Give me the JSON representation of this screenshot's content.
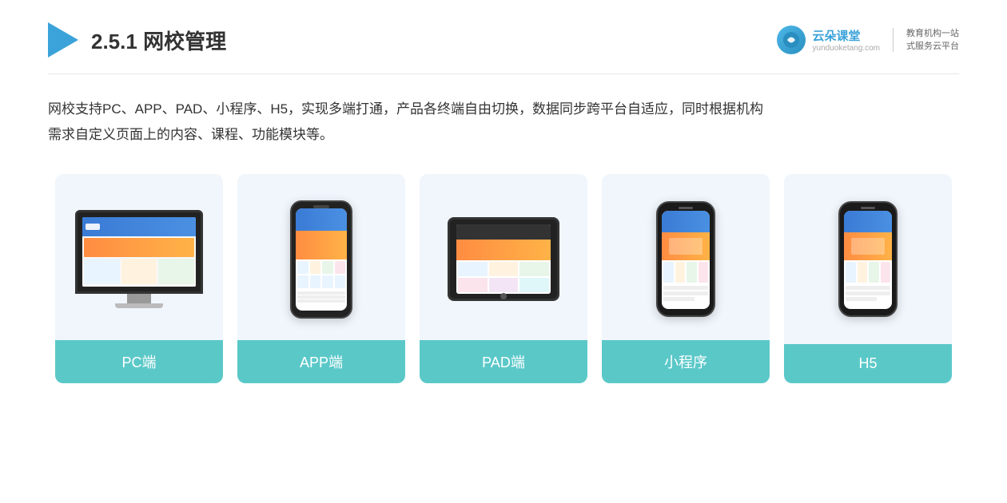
{
  "header": {
    "title_prefix": "2.5.1 ",
    "title_bold": "网校管理",
    "brand_name": "云朵课堂",
    "brand_url": "yunduoketang.com",
    "brand_slogan_line1": "教育机构一站",
    "brand_slogan_line2": "式服务云平台"
  },
  "description": {
    "text_line1": "网校支持PC、APP、PAD、小程序、H5，实现多端打通，产品各终端自由切换，数据同步跨平台自适应，同时根据机构",
    "text_line2": "需求自定义页面上的内容、课程、功能模块等。"
  },
  "cards": [
    {
      "id": "pc",
      "label": "PC端"
    },
    {
      "id": "app",
      "label": "APP端"
    },
    {
      "id": "pad",
      "label": "PAD端"
    },
    {
      "id": "miniapp",
      "label": "小程序"
    },
    {
      "id": "h5",
      "label": "H5"
    }
  ]
}
